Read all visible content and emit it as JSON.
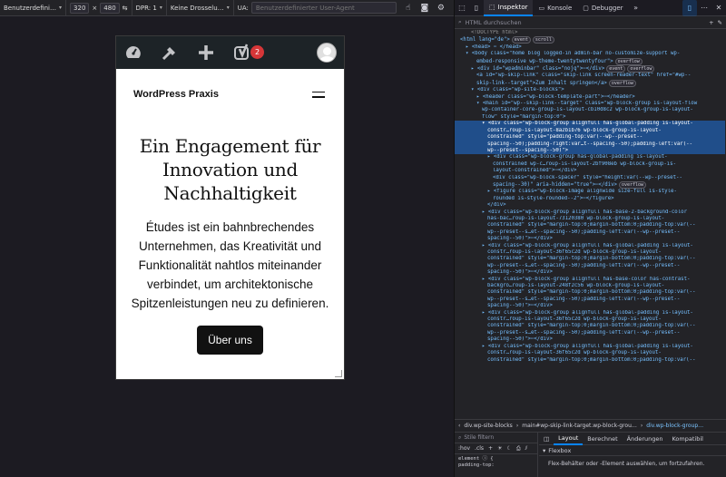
{
  "rdm_toolbar": {
    "device": "Benutzerdefini…",
    "width": "320",
    "height": "480",
    "dpr": "DPR: 1",
    "throttling": "Keine Drosselu…",
    "ua_label": "UA:",
    "ua_placeholder": "Benutzerdefinierter User-Agent"
  },
  "site": {
    "adminbar_badge": "2",
    "title": "WordPress Praxis",
    "heading": "Ein Engagement für Innovation und Nachhaltigkeit",
    "text": "Études ist ein bahnbrechendes Unternehmen, das Kreativität und Funktionalität nahtlos miteinander verbindet, um architektonische Spitzenleistungen neu zu definieren.",
    "cta": "Über uns"
  },
  "devtools": {
    "tabs": [
      {
        "label": "Inspektor"
      },
      {
        "label": "Konsole"
      },
      {
        "label": "Debugger"
      }
    ],
    "search_placeholder": "HTML durchsuchen",
    "breadcrumbs": [
      "div.wp-site-blocks",
      "main#wp-skip-link-target.wp-block-grou…",
      "div.wp-block-group…"
    ],
    "rules_filter": "Stile filtern",
    "rules_ctrls": [
      ":hov",
      ".cls"
    ],
    "rules_code": [
      "element ⓘ {",
      "    padding-top:"
    ],
    "layout_tabs": [
      "Layout",
      "Berechnet",
      "Änderungen",
      "Kompatibil"
    ],
    "flexbox_label": "Flexbox",
    "flexbox_hint": "Flex-Behälter oder -Element auswählen, um fortzufahren.",
    "markup": [
      {
        "t": "<!DOCTYPE html>",
        "c": "cmt",
        "i": 3
      },
      {
        "t": "<html lang=\"de\">",
        "c": "tag",
        "i": 1,
        "pills": [
          "event",
          "scroll"
        ]
      },
      {
        "t": "▸ <head> ⋯ </head>",
        "c": "tag",
        "i": 2
      },
      {
        "t": "▾ <body class=\"home blog logged-in admin-bar no-customize-support wp-",
        "c": "tag",
        "i": 2
      },
      {
        "t": "embed-responsive wp-theme-twentytwentyfour\">",
        "c": "tag",
        "i": 4,
        "pills": [
          "overflow"
        ]
      },
      {
        "t": "▸ <div id=\"wpadminbar\" class=\"nojq\">⋯</div>",
        "c": "tag",
        "i": 3,
        "pills": [
          "event",
          "overflow"
        ]
      },
      {
        "t": "<a id=\"wp-skip-link\" class=\"skip-link screen-reader-text\" href=\"#wp--",
        "c": "tag",
        "i": 4
      },
      {
        "t": "skip-link--target\">Zum Inhalt springen</a>",
        "c": "tag",
        "i": 4,
        "pills": [
          "overflow"
        ]
      },
      {
        "t": "▾ <div class=\"wp-site-blocks\">",
        "c": "tag",
        "i": 3
      },
      {
        "t": "▸ <header class=\"wp-block-template-part\">⋯</header>",
        "c": "tag",
        "i": 4
      },
      {
        "t": "▾ <main id=\"wp--skip-link--target\" class=\"wp-block-group is-layout-flow",
        "c": "tag",
        "i": 4
      },
      {
        "t": "wp-container-core-group-is-layout-cb10d8c2 wp-block-group-is-layout-",
        "c": "tag",
        "i": 5
      },
      {
        "t": "flow\" style=\"margin-top:0\">",
        "c": "tag",
        "i": 5
      },
      {
        "t": "▾ <div class=\"wp-block-group alignfull has-global-padding is-layout-",
        "c": "tag",
        "i": 5,
        "sel": true
      },
      {
        "t": "constr…roup-is-layout-8a2b1b76 wp-block-group-is-layout-",
        "c": "tag",
        "i": 6,
        "sel": true
      },
      {
        "t": "constrained\" style=\"padding-top:var(--wp--preset--",
        "c": "tag",
        "i": 6,
        "sel": true
      },
      {
        "t": "spacing--50);padding-right:var…t--spacing--50);padding-left:var(--",
        "c": "tag",
        "i": 6,
        "sel": true
      },
      {
        "t": "wp--preset--spacing--50)\">",
        "c": "tag",
        "i": 6,
        "sel": true
      },
      {
        "t": "▸ <div class=\"wp-block-group has-global-padding is-layout-",
        "c": "tag",
        "i": 6
      },
      {
        "t": "constrained wp-c…roup-is-layout-2bf908eb wp-block-group-is-",
        "c": "tag",
        "i": 7
      },
      {
        "t": "layout-constrained\">⋯</div>",
        "c": "tag",
        "i": 7
      },
      {
        "t": "<div class=\"wp-block-spacer\" style=\"height:var(--wp--preset--",
        "c": "tag",
        "i": 7
      },
      {
        "t": "spacing--30)\" aria-hidden=\"true\">⋯</div>",
        "c": "tag",
        "i": 7,
        "pills": [
          "overflow"
        ]
      },
      {
        "t": "▸ <figure class=\"wp-block-image alignwide size-full is-style-",
        "c": "tag",
        "i": 6
      },
      {
        "t": "rounded is-style-rounded--2\">⋯</figure>",
        "c": "tag",
        "i": 7
      },
      {
        "t": "</div>",
        "c": "tag",
        "i": 6
      },
      {
        "t": "▸ <div class=\"wp-block-group alignfull has-base-2-background-color",
        "c": "tag",
        "i": 5
      },
      {
        "t": "has-bac…roup-is-layout-73120380 wp-block-group-is-layout-",
        "c": "tag",
        "i": 6
      },
      {
        "t": "constrained\" style=\"margin-top:0;margin-bottom:0;padding-top:var(--",
        "c": "tag",
        "i": 6
      },
      {
        "t": "wp--preset--s…et--spacing--50);padding-left:var(--wp--preset--",
        "c": "tag",
        "i": 6
      },
      {
        "t": "spacing--50)\">⋯</div>",
        "c": "tag",
        "i": 6
      },
      {
        "t": "▸ <div class=\"wp-block-group alignfull has-global-padding is-layout-",
        "c": "tag",
        "i": 5
      },
      {
        "t": "constr…roup-is-layout-36f65c2d wp-block-group-is-layout-",
        "c": "tag",
        "i": 6
      },
      {
        "t": "constrained\" style=\"margin-top:0;margin-bottom:0;padding-top:var(--",
        "c": "tag",
        "i": 6
      },
      {
        "t": "wp--preset--s…et--spacing--50);padding-left:var(--wp--preset--",
        "c": "tag",
        "i": 6
      },
      {
        "t": "spacing--50)\">⋯</div>",
        "c": "tag",
        "i": 6
      },
      {
        "t": "▸ <div class=\"wp-block-group alignfull has-base-color has-contrast-",
        "c": "tag",
        "i": 5
      },
      {
        "t": "backgro…roup-is-layout-248f2c56 wp-block-group-is-layout-",
        "c": "tag",
        "i": 6
      },
      {
        "t": "constrained\" style=\"margin-top:0;margin-bottom:0;padding-top:var(--",
        "c": "tag",
        "i": 6
      },
      {
        "t": "wp--preset--s…et--spacing--50);padding-left:var(--wp--preset--",
        "c": "tag",
        "i": 6
      },
      {
        "t": "spacing--50)\">⋯</div>",
        "c": "tag",
        "i": 6
      },
      {
        "t": "▸ <div class=\"wp-block-group alignfull has-global-padding is-layout-",
        "c": "tag",
        "i": 5
      },
      {
        "t": "constr…roup-is-layout-36f65c2d wp-block-group-is-layout-",
        "c": "tag",
        "i": 6
      },
      {
        "t": "constrained\" style=\"margin-top:0;margin-bottom:0;padding-top:var(--",
        "c": "tag",
        "i": 6
      },
      {
        "t": "wp--preset--s…et--spacing--50);padding-left:var(--wp--preset--",
        "c": "tag",
        "i": 6
      },
      {
        "t": "spacing--50)\">⋯</div>",
        "c": "tag",
        "i": 6
      },
      {
        "t": "▸ <div class=\"wp-block-group alignfull has-global-padding is-layout-",
        "c": "tag",
        "i": 5
      },
      {
        "t": "constr…roup-is-layout-36f65c2d wp-block-group-is-layout-",
        "c": "tag",
        "i": 6
      },
      {
        "t": "constrained\" style=\"margin-top:0;margin-bottom:0;padding-top:var(--",
        "c": "tag",
        "i": 6
      }
    ]
  },
  "colors": {
    "accent": "#0a84ff",
    "selection": "#204e8a",
    "adminbar": "#1d2327",
    "badge": "#d63638"
  }
}
